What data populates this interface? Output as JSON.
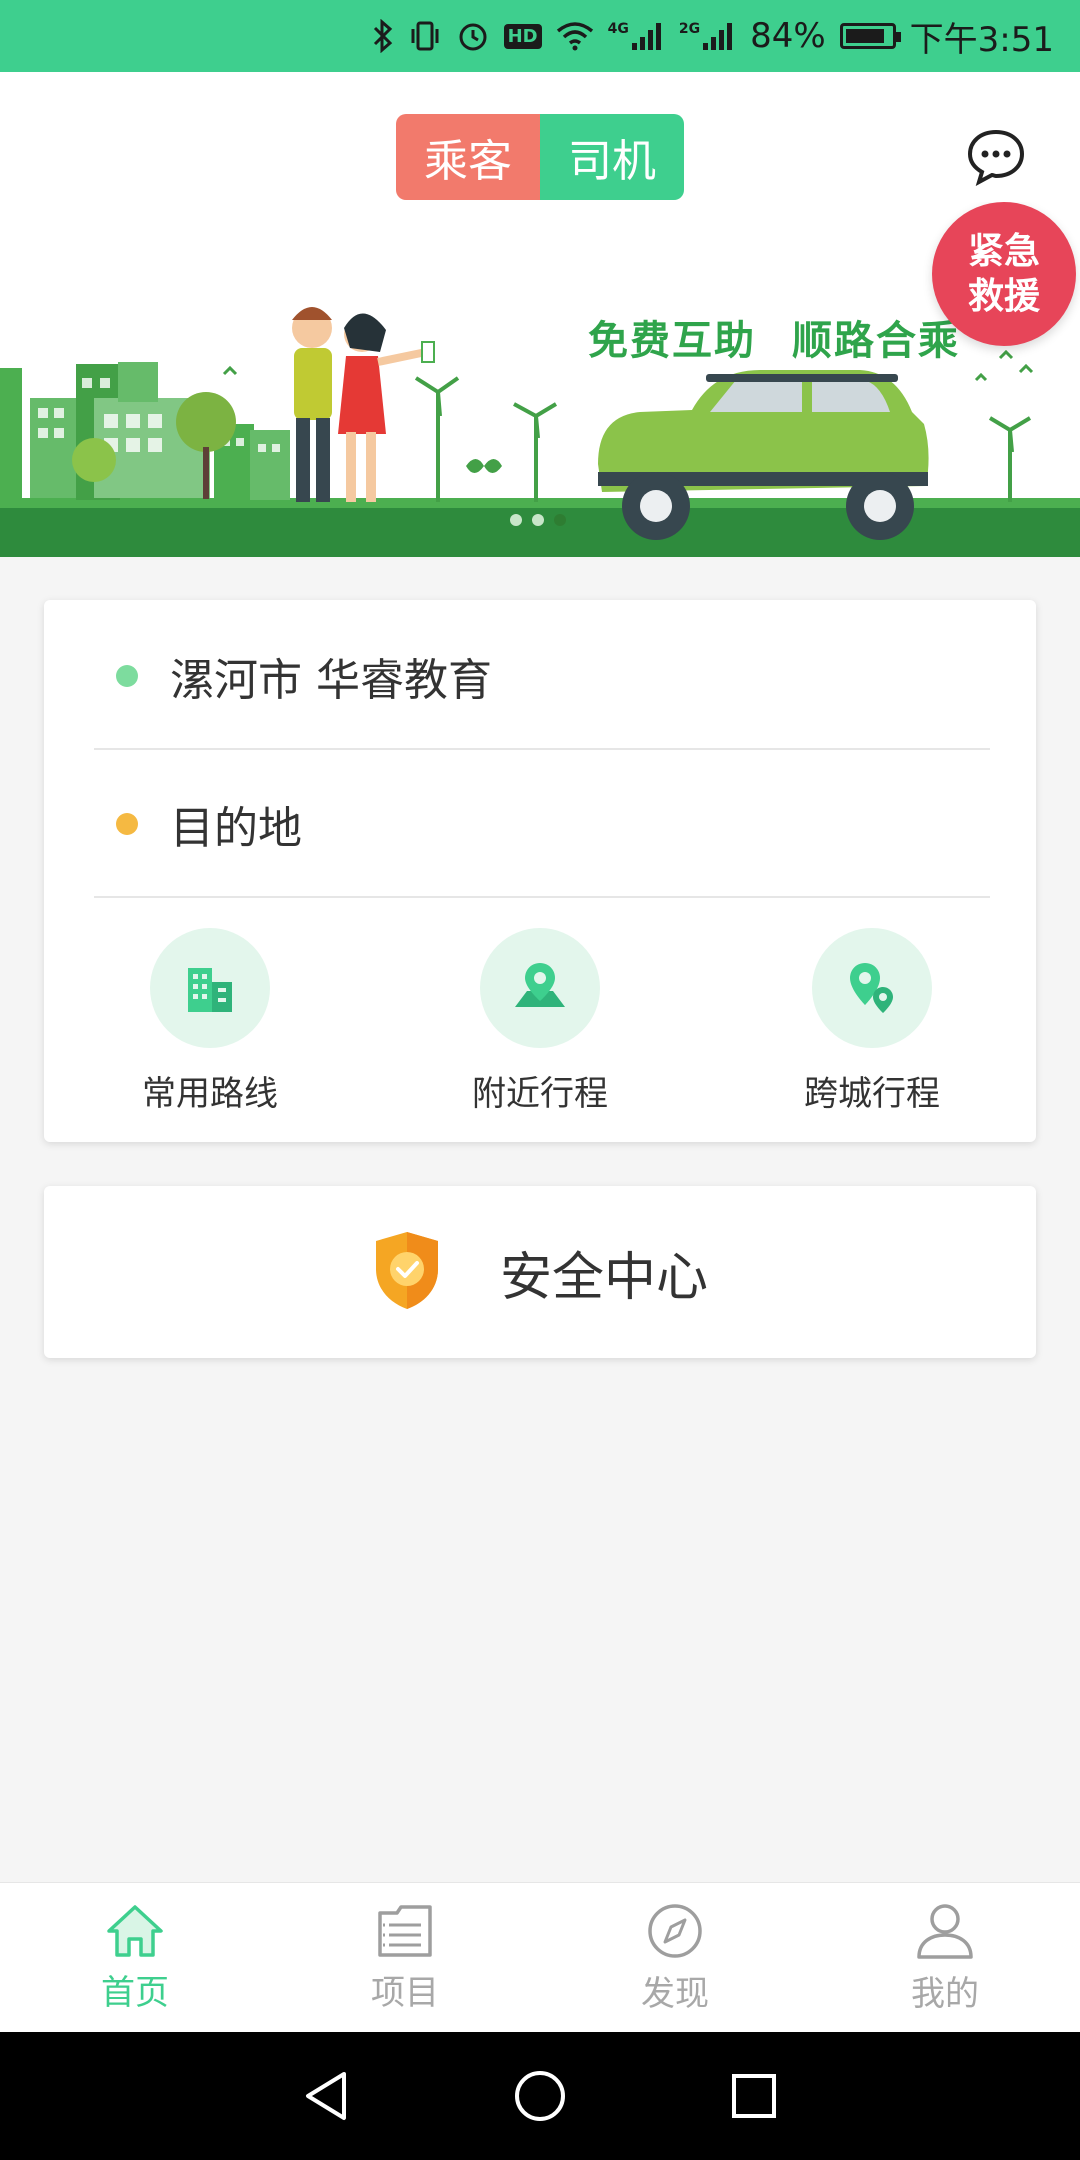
{
  "status_bar": {
    "net1": "4G",
    "net2": "2G",
    "battery": "84%",
    "time": "下午3:51",
    "hd": "HD"
  },
  "header": {
    "passenger_label": "乘客",
    "driver_label": "司机",
    "active_mode": "乘客"
  },
  "banner": {
    "slogan_left": "免费互助",
    "slogan_right": "顺路合乘",
    "sos_line1": "紧急",
    "sos_line2": "救援",
    "slides_count": 3,
    "active_slide": 3
  },
  "route": {
    "origin": "漯河市 华睿教育",
    "destination": "目的地",
    "origin_dot_color": "#7ddc9e",
    "destination_dot_color": "#f5b942"
  },
  "quick_actions": [
    {
      "label": "常用路线",
      "icon": "building-icon"
    },
    {
      "label": "附近行程",
      "icon": "map-pin-icon"
    },
    {
      "label": "跨城行程",
      "icon": "multi-location-icon"
    }
  ],
  "safety": {
    "label": "安全中心",
    "icon": "shield-check-icon"
  },
  "bottom_nav": [
    {
      "label": "首页",
      "icon": "home-icon",
      "active": true
    },
    {
      "label": "项目",
      "icon": "folder-list-icon",
      "active": false
    },
    {
      "label": "发现",
      "icon": "compass-icon",
      "active": false
    },
    {
      "label": "我的",
      "icon": "person-icon",
      "active": false
    }
  ],
  "colors": {
    "accent": "#3ecf8e",
    "passenger": "#f27a6c",
    "sos": "#e74559",
    "shield": "#f5a623"
  }
}
